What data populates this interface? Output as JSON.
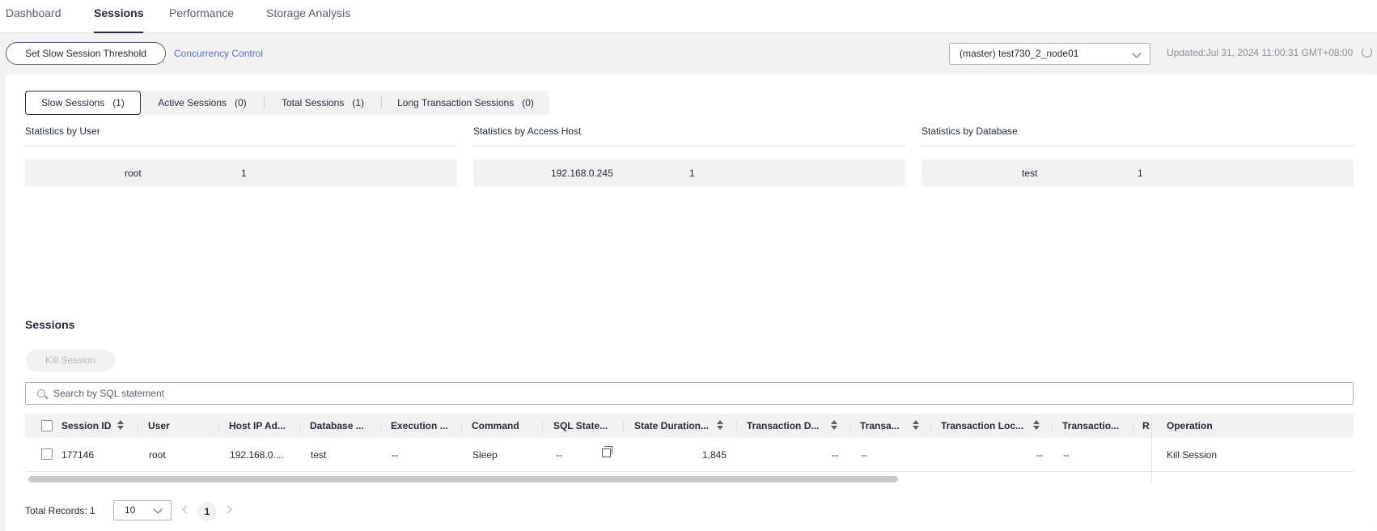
{
  "top_tabs": {
    "dashboard": "Dashboard",
    "sessions": "Sessions",
    "performance": "Performance",
    "storage": "Storage Analysis"
  },
  "toolbar": {
    "threshold_label": "Set Slow Session Threshold",
    "concurrency_label": "Concurrency Control",
    "instance_value": "(master) test730_2_node01",
    "updated_text": "Updated:Jul 31, 2024 11:00:31 GMT+08:00"
  },
  "session_tabs": [
    {
      "label": "Slow Sessions",
      "count": "(1)"
    },
    {
      "label": "Active Sessions",
      "count": "(0)"
    },
    {
      "label": "Total Sessions",
      "count": "(1)"
    },
    {
      "label": "Long Transaction Sessions",
      "count": "(0)"
    }
  ],
  "stats": {
    "by_user": {
      "title": "Statistics by User",
      "key": "root",
      "value": "1"
    },
    "by_host": {
      "title": "Statistics by Access Host",
      "key": "192.168.0.245",
      "value": "1"
    },
    "by_db": {
      "title": "Statistics by Database",
      "key": "test",
      "value": "1"
    }
  },
  "sessions": {
    "title": "Sessions",
    "kill_label": "Kill Session",
    "search_placeholder": "Search by SQL statement",
    "columns": {
      "session_id": "Session ID",
      "user": "User",
      "host": "Host IP Ad...",
      "database": "Database ...",
      "execution": "Execution ...",
      "command": "Command",
      "sql": "SQL State...",
      "state_duration": "State Duration...",
      "trx_d": "Transaction D...",
      "trx_a": "Transa...",
      "trx_loc": "Transaction Loc...",
      "trx_i": "Transactio...",
      "r": "R",
      "operation": "Operation"
    },
    "row": {
      "session_id": "177146",
      "user": "root",
      "host": "192.168.0....",
      "database": "test",
      "execution": "--",
      "command": "Sleep",
      "sql": "--",
      "state_duration": "1,845",
      "trx_d": "--",
      "trx_a": "--",
      "trx_loc": "--",
      "trx_i": "--",
      "operation": "Kill Session"
    }
  },
  "pagination": {
    "total_label": "Total Records: 1",
    "page_size": "10",
    "current_page": "1"
  },
  "colors": {
    "link": "#526ecc",
    "text": "#252b3a",
    "muted": "#8a8e99",
    "background": "#f2f2f2"
  }
}
